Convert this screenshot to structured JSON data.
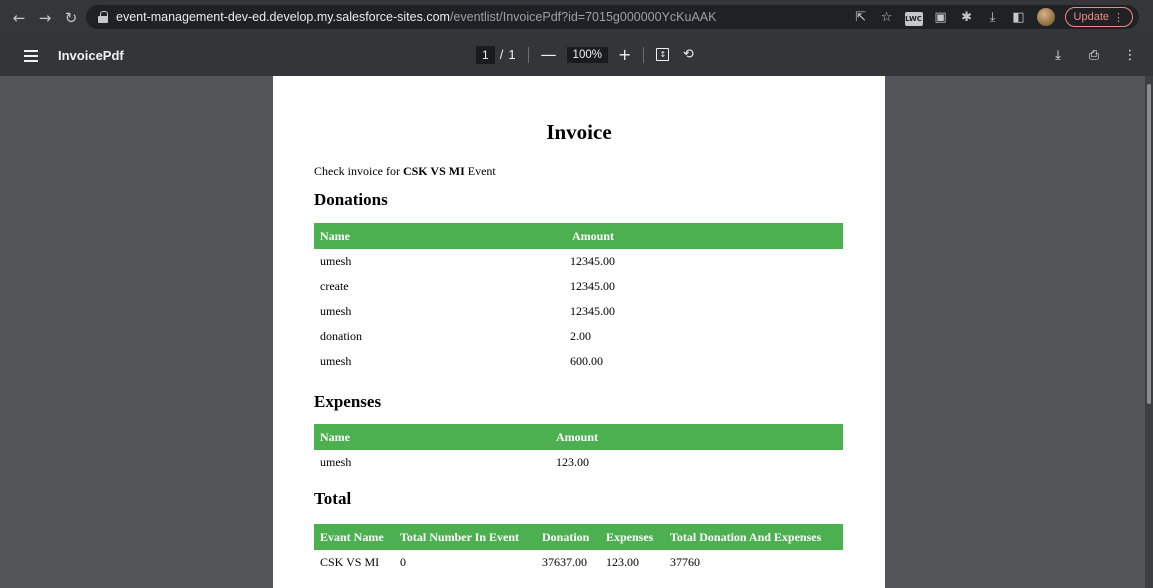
{
  "browser": {
    "url_domain": "event-management-dev-ed.develop.my.salesforce-sites.com",
    "url_path": "/eventlist/InvoicePdf?id=7015g000000YcKuAAK",
    "update_label": "Update"
  },
  "pdf_viewer": {
    "title": "InvoicePdf",
    "current_page": "1",
    "page_sep": "/",
    "total_pages": "1",
    "zoom": "100%"
  },
  "invoice": {
    "title": "Invoice",
    "intro_prefix": "Check invoice for",
    "event_name": "CSK VS MI",
    "intro_suffix": "Event",
    "donations": {
      "heading": "Donations",
      "headers": [
        "Name",
        "Amount"
      ],
      "rows": [
        [
          "umesh",
          "12345.00"
        ],
        [
          "create",
          "12345.00"
        ],
        [
          "umesh",
          "12345.00"
        ],
        [
          "donation",
          "2.00"
        ],
        [
          "umesh",
          "600.00"
        ]
      ]
    },
    "expenses": {
      "heading": "Expenses",
      "headers": [
        "Name",
        "Amount"
      ],
      "rows": [
        [
          "umesh",
          "123.00"
        ]
      ]
    },
    "total": {
      "heading": "Total",
      "headers": [
        "Evant Name",
        "Total Number In Event",
        "Donation",
        "Expenses",
        "Total Donation And Expenses"
      ],
      "rows": [
        [
          "CSK VS MI",
          "0",
          "37637.00",
          "123.00",
          "37760"
        ]
      ]
    }
  },
  "colors": {
    "table_header": "#4caf50",
    "toolbar": "#323639",
    "viewer_bg": "#525659"
  }
}
